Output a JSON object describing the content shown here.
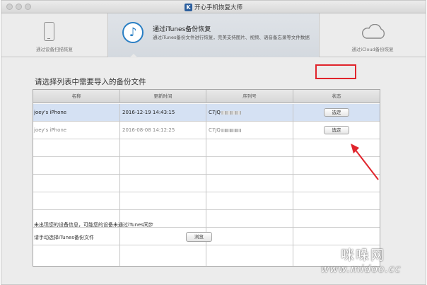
{
  "window": {
    "title": "开心手机恢复大师",
    "logo_letter": "K"
  },
  "modes": {
    "device": {
      "label": "通过设备扫描恢复",
      "icon": "phone-icon"
    },
    "itunes": {
      "title": "通过iTunes备份恢复",
      "description": "通过iTunes备份文件进行恢复，完美支持图片、视频、语音备忘录等文件数据",
      "icon": "music-note-icon",
      "glyph": "♪"
    },
    "icloud": {
      "label": "通过iCloud备份恢复",
      "icon": "cloud-icon"
    }
  },
  "prompt": "请选择列表中需要导入的备份文件",
  "table": {
    "columns": [
      "名称",
      "更新时间",
      "序列号",
      "状态"
    ],
    "rows": [
      {
        "name": "joey's iPhone",
        "time": "2016-12-19 14:43:15",
        "serial": "C7JQ",
        "action": "选定",
        "selected": true
      },
      {
        "name": "joey's iPhone",
        "time": "2016-08-08 14:12:25",
        "serial": "C7JQ",
        "action": "选定",
        "selected": false
      }
    ]
  },
  "footer": {
    "note": "未出现您的设备信息，可能您的设备未通过iTunes同步",
    "manual_label": "请手动选择iTunes备份文件",
    "browse_button": "浏览"
  },
  "watermark": {
    "main": "咪哚网",
    "url": "www.midoo.cc"
  },
  "colors": {
    "highlight": "#e0242c",
    "selected_row": "#d5e1f3",
    "accent": "#2a7fc4"
  }
}
